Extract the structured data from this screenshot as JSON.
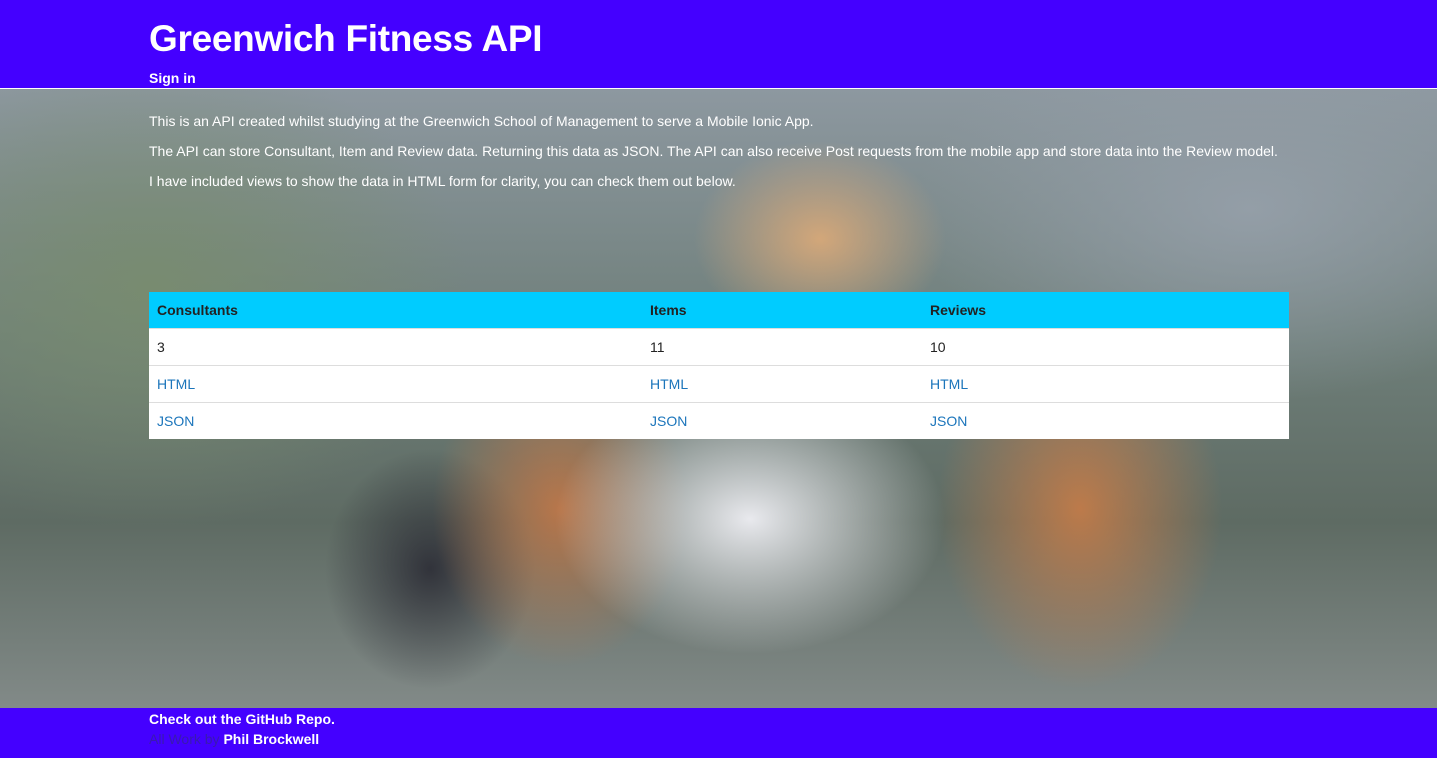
{
  "header": {
    "title": "Greenwich Fitness API",
    "signin_label": "Sign in",
    "background_color": "#4400ff"
  },
  "intro": {
    "line1": "This is an API created whilst studying at the Greenwich School of Management to serve a Mobile Ionic App.",
    "line2": "The API can store Consultant, Item and Review data. Returning this data as JSON. The API can also receive Post requests from the mobile app and store data into the Review model.",
    "line3": "I have included views to show the data in HTML form for clarity, you can check them out below."
  },
  "table": {
    "header_color": "#00ccff",
    "columns": [
      "Consultants",
      "Items",
      "Reviews"
    ],
    "counts": [
      "3",
      "11",
      "10"
    ],
    "html_links": [
      "HTML",
      "HTML",
      "HTML"
    ],
    "json_links": [
      "JSON",
      "JSON",
      "JSON"
    ]
  },
  "footer": {
    "repo_link": "Check out the GitHub Repo.",
    "credit_prefix": "All Work by",
    "credit_name": "Phil Brockwell",
    "background_color": "#4400ff"
  }
}
